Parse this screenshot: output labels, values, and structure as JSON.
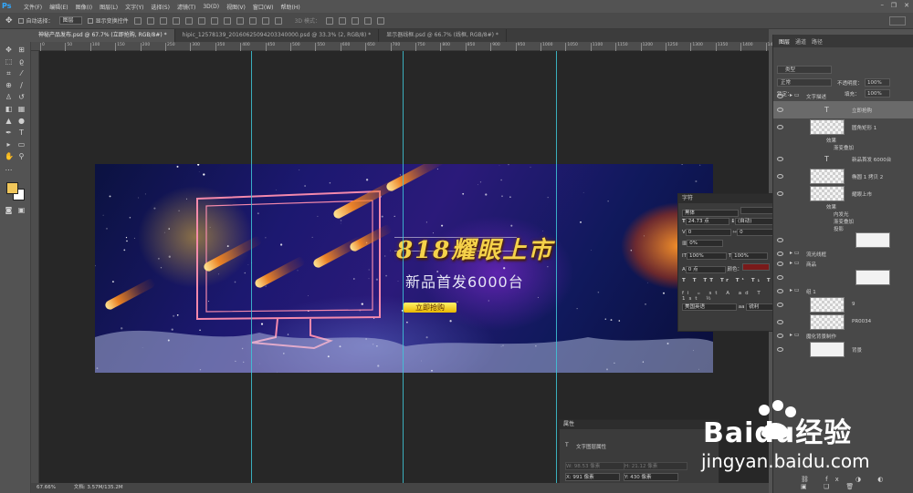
{
  "menubar": {
    "logo": "Ps",
    "items": [
      "文件(F)",
      "编辑(E)",
      "图像(I)",
      "图层(L)",
      "文字(Y)",
      "选择(S)",
      "滤镜(T)",
      "3D(D)",
      "视图(V)",
      "窗口(W)",
      "帮助(H)"
    ]
  },
  "options": {
    "auto_select_label": "自动选择：",
    "auto_select_value": "图层",
    "show_transform_label": "显示变换控件",
    "mode_3d_label": "3D 模式："
  },
  "tabs": [
    {
      "label": "神秘产品发布.psd @ 67.7% (立即抢购, RGB/8#) *",
      "active": true
    },
    {
      "label": "hipic_12578139_20160625094203340000.psd @ 33.3% (2, RGB/8) *",
      "active": false
    },
    {
      "label": "显示器线框.psd @ 66.7% (线框, RGB/8#) *",
      "active": false
    }
  ],
  "ruler": {
    "top_marks": [
      "0",
      "50",
      "100",
      "150",
      "200",
      "250",
      "300",
      "350",
      "400",
      "450",
      "500",
      "550",
      "600",
      "650",
      "700",
      "750",
      "800",
      "850",
      "900",
      "950",
      "1000",
      "1050",
      "1100",
      "1150",
      "1200",
      "1250",
      "1300",
      "1350",
      "1400",
      "1450"
    ]
  },
  "banner": {
    "title": "818耀眼上市",
    "subtitle": "新品首发6000台",
    "button": "立即抢购"
  },
  "character_panel": {
    "title": "字符",
    "font_family": "黑体",
    "font_size": "24.73 点",
    "leading": "(自动)",
    "kerning": "0",
    "tracking": "0",
    "vertical_scale": "100%",
    "horizontal_scale": "100%",
    "baseline": "0 点",
    "color_label": "颜色：",
    "color_value": "#7a1a1a",
    "language": "美国英语",
    "antialias": "锐利",
    "style_buttons": [
      "T",
      "T",
      "TT",
      "Tr",
      "T¹",
      "T₁",
      "T",
      "T"
    ]
  },
  "layers_panel": {
    "tabs": [
      "图层",
      "通道",
      "路径"
    ],
    "kind_label": "类型",
    "blend_mode": "正常",
    "opacity_label": "不透明度：",
    "opacity": "100%",
    "lock_label": "锁定：",
    "fill_label": "填充：",
    "fill": "100%",
    "layers": [
      {
        "name": "文字描述",
        "kind": "group"
      },
      {
        "name": "立即抢购",
        "kind": "text",
        "selected": true
      },
      {
        "name": "圆角矩形 1",
        "kind": "shape"
      },
      {
        "name": "效果",
        "kind": "effect"
      },
      {
        "name": "渐变叠加",
        "kind": "effect"
      },
      {
        "name": "新品首发 6000台",
        "kind": "text"
      },
      {
        "name": "椭圆 1 拷贝 2",
        "kind": "shape"
      },
      {
        "name": "耀眼上市",
        "kind": "shape"
      },
      {
        "name": "效果",
        "kind": "effect"
      },
      {
        "name": "内发光",
        "kind": "effect"
      },
      {
        "name": "渐变叠加",
        "kind": "effect"
      },
      {
        "name": "投影",
        "kind": "effect"
      },
      {
        "name": "",
        "kind": "clip"
      },
      {
        "name": "流光线框",
        "kind": "group"
      },
      {
        "name": "商品",
        "kind": "group"
      },
      {
        "name": "",
        "kind": "clip"
      },
      {
        "name": "组 1",
        "kind": "group"
      },
      {
        "name": "9",
        "kind": "pixel"
      },
      {
        "name": "PR0034",
        "kind": "pixel"
      },
      {
        "name": "魔化背景制作",
        "kind": "group"
      },
      {
        "name": "背景",
        "kind": "background"
      }
    ]
  },
  "properties_panel": {
    "title": "属性",
    "subtitle": "文字图层属性",
    "w_label": "W: 98.53 像素",
    "h_label": "H: 21.12 像素",
    "x_label": "X: 991 像素",
    "y_label": "Y: 430 像素"
  },
  "status": {
    "zoom": "67.66%",
    "doc": "文档: 3.57M/135.2M"
  },
  "watermark": {
    "brand": "Baidu经验",
    "url": "jingyan.baidu.com"
  }
}
